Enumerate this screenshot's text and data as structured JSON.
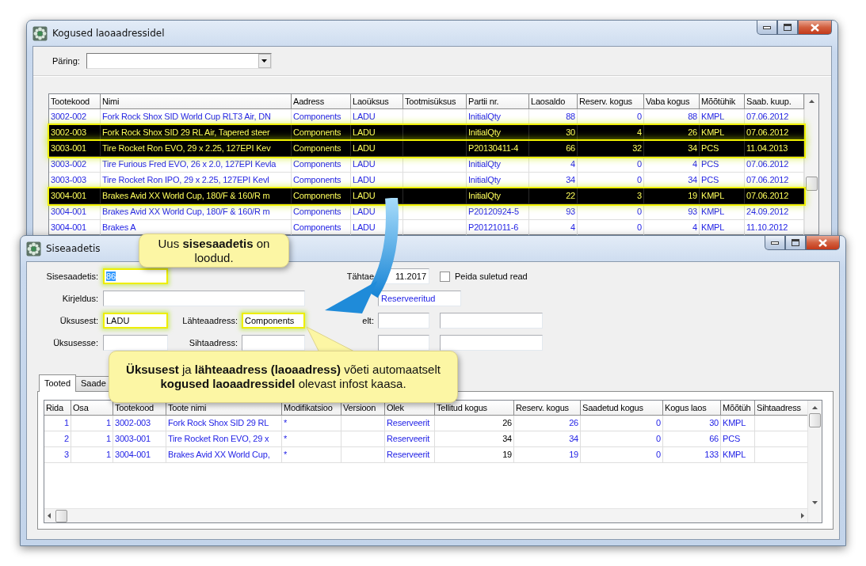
{
  "main_window": {
    "title": "Kogused laoaadressidel",
    "query": {
      "label": "Päring:"
    },
    "table": {
      "columns": [
        "Tootekood",
        "Nimi",
        "Aadress",
        "Laoüksus",
        "Tootmisüksus",
        "Partii nr.",
        "Laosaldo",
        "Reserv. kogus",
        "Vaba kogus",
        "Mõõtühik",
        "Saab. kuup."
      ],
      "rows": [
        {
          "code": "3002-002",
          "name": "Fork Rock Shox SID World Cup RLT3 Air, DN",
          "address": "Components",
          "unit": "LADU",
          "batch": "InitialQty",
          "balance": "88",
          "reserved": "0",
          "free": "88",
          "uom": "KMPL",
          "arrival": "07.06.2012",
          "highlighted": false
        },
        {
          "code": "3002-003",
          "name": "Fork Rock Shox SID 29 RL Air, Tapered steer",
          "address": "Components",
          "unit": "LADU",
          "batch": "InitialQty",
          "balance": "30",
          "reserved": "4",
          "free": "26",
          "uom": "KMPL",
          "arrival": "07.06.2012",
          "highlighted": true
        },
        {
          "code": "3003-001",
          "name": "Tire Rocket Ron EVO, 29 x 2.25, 127EPI Kev",
          "address": "Components",
          "unit": "LADU",
          "batch": "P20130411-4",
          "balance": "66",
          "reserved": "32",
          "free": "34",
          "uom": "PCS",
          "arrival": "11.04.2013",
          "highlighted": true
        },
        {
          "code": "3003-002",
          "name": "Tire Furious Fred EVO, 26 x 2.0, 127EPI Kevla",
          "address": "Components",
          "unit": "LADU",
          "batch": "InitialQty",
          "balance": "4",
          "reserved": "0",
          "free": "4",
          "uom": "PCS",
          "arrival": "07.06.2012",
          "highlighted": false
        },
        {
          "code": "3003-003",
          "name": "Tire Rocket Ron IPO, 29 x 2.25, 127EPI Kevl",
          "address": "Components",
          "unit": "LADU",
          "batch": "InitialQty",
          "balance": "34",
          "reserved": "0",
          "free": "34",
          "uom": "PCS",
          "arrival": "07.06.2012",
          "highlighted": false
        },
        {
          "code": "3004-001",
          "name": "Brakes Avid XX World Cup, 180/F & 160/R m",
          "address": "Components",
          "unit": "LADU",
          "batch": "InitialQty",
          "balance": "22",
          "reserved": "3",
          "free": "19",
          "uom": "KMPL",
          "arrival": "07.06.2012",
          "highlighted": true
        },
        {
          "code": "3004-001",
          "name": "Brakes Avid XX World Cup, 180/F & 160/R m",
          "address": "Components",
          "unit": "LADU",
          "batch": "P20120924-5",
          "balance": "93",
          "reserved": "0",
          "free": "93",
          "uom": "KMPL",
          "arrival": "24.09.2012",
          "highlighted": false
        },
        {
          "code": "3004-001",
          "name": "Brakes A",
          "address": "Components",
          "unit": "LADU",
          "batch": "P20121011-6",
          "balance": "4",
          "reserved": "0",
          "free": "4",
          "uom": "KMPL",
          "arrival": "11.10.2012",
          "highlighted": false
        }
      ]
    }
  },
  "document_window": {
    "title": "Siseaadetis",
    "form": [
      {
        "kind": "input",
        "label": "Sisesaadetis:",
        "value": "86",
        "highlighted": true,
        "value_selected": true
      },
      {
        "kind": "date",
        "label": "Tähtae",
        "value": "11.2017",
        "highlighted": false,
        "value_selected": false
      },
      {
        "kind": "input",
        "label": "Kirjeldus:",
        "highlighted": false
      },
      {
        "kind": "status",
        "value": "Reserveeritud",
        "highlighted": false,
        "value_selected": false
      },
      {
        "kind": "input",
        "label": "Üksusest:",
        "value": "LADU",
        "highlighted": true,
        "value_selected": false
      },
      {
        "kind": "input",
        "label": "Lähteaadress:",
        "value": "Components",
        "highlighted": true,
        "value_selected": false
      },
      {
        "kind": "input",
        "label": "elt:",
        "highlighted": false
      },
      {
        "kind": "input",
        "highlighted": false
      },
      {
        "kind": "input",
        "label": "Üksusesse:",
        "highlighted": false
      },
      {
        "kind": "input",
        "label": "Sihtaadress:",
        "highlighted": false
      },
      {
        "kind": "input",
        "highlighted": false
      },
      {
        "kind": "input",
        "highlighted": false
      }
    ],
    "checkbox": {
      "label": "Peida suletud read",
      "checked": false
    },
    "tabs": [
      {
        "label": "Tooted",
        "selected": true
      },
      {
        "label": "Saade",
        "selected": false
      }
    ],
    "table": {
      "columns": [
        "Rida",
        "Osa",
        "Tootekood",
        "Toote nimi",
        "Modifikatsioo",
        "Versioon",
        "Olek",
        "Tellitud kogus",
        "Reserv. kogus",
        "Saadetud kogus",
        "Kogus laos",
        "Mõõtüh",
        "Sihtaadress"
      ],
      "rows": [
        {
          "line": "1",
          "part": "1",
          "code": "3002-003",
          "name": "Fork Rock Shox SID 29 RL",
          "modification": "*",
          "status": "Reserveerit",
          "ordered": "26",
          "reserved": "26",
          "sent": "0",
          "in_stock": "30",
          "uom": "KMPL"
        },
        {
          "line": "2",
          "part": "1",
          "code": "3003-001",
          "name": "Tire Rocket Ron EVO, 29 x",
          "modification": "*",
          "status": "Reserveerit",
          "ordered": "34",
          "reserved": "34",
          "sent": "0",
          "in_stock": "66",
          "uom": "PCS"
        },
        {
          "line": "3",
          "part": "1",
          "code": "3004-001",
          "name": "Brakes Avid XX World Cup,",
          "modification": "*",
          "status": "Reserveerit",
          "ordered": "19",
          "reserved": "19",
          "sent": "0",
          "in_stock": "133",
          "uom": "KMPL"
        }
      ]
    }
  },
  "callouts": [
    {
      "text": "Uus **sisesaadetis** on\nloodud."
    },
    {
      "text": "**Üksusest** ja **lähteaadress (laoaadress)** võeti automaatselt\n**kogused laoaadressidel** olevast infost kaasa."
    }
  ]
}
